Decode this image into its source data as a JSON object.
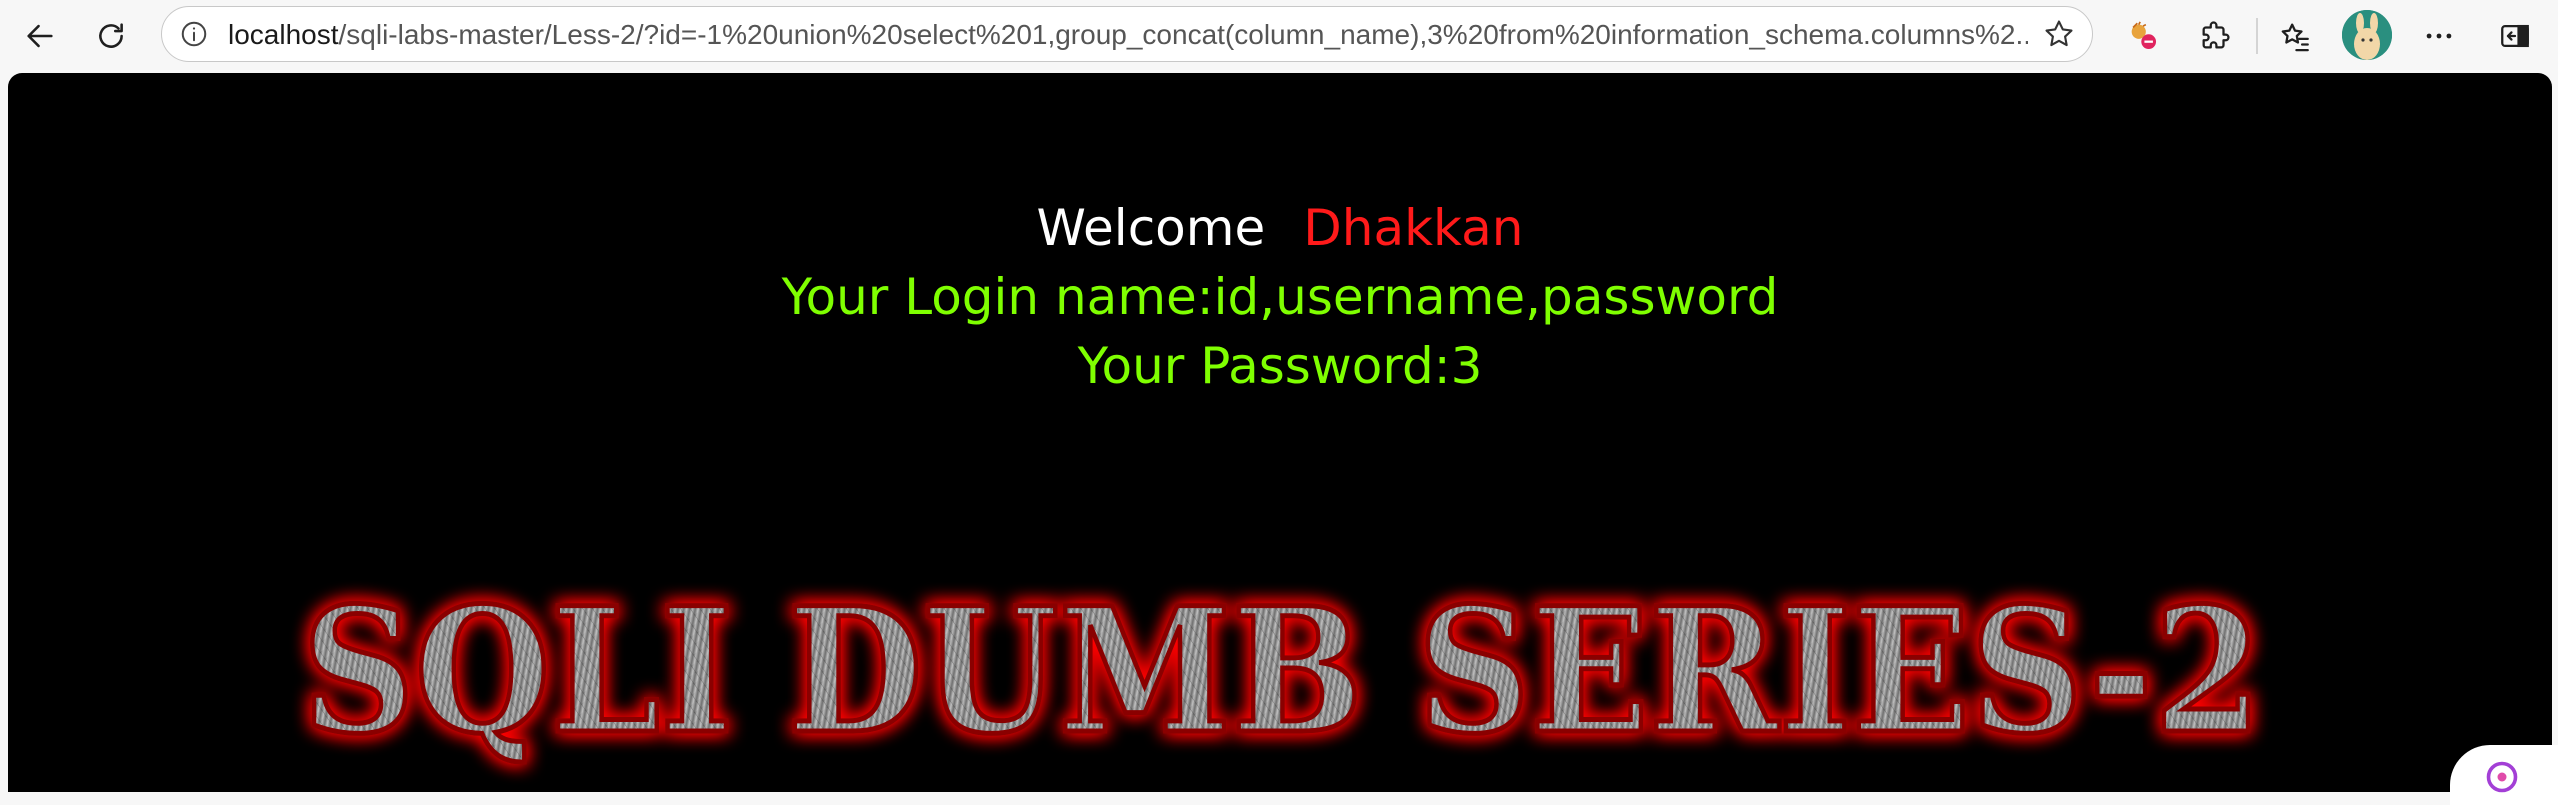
{
  "browser": {
    "url_host": "localhost",
    "url_rest": "/sqli-labs-master/Less-2/?id=-1%20union%20select%201,group_concat(column_name),3%20from%20information_schema.columns%2...",
    "icons": {
      "back": "back-arrow-icon",
      "reload": "reload-icon",
      "info": "site-info-icon",
      "favorite": "star-icon",
      "extension_blocked": "blocked-extension-icon",
      "extensions": "puzzle-icon",
      "favorites": "favorites-icon",
      "profile": "avatar",
      "more": "more-icon",
      "sidebar": "sidebar-icon"
    }
  },
  "page": {
    "welcome_label": "Welcome",
    "user_name": "Dhakkan",
    "login_line": "Your Login name:id,username,password",
    "password_line": "Your Password:3",
    "banner_text": "SQLI DUMB SERIES-2",
    "colors": {
      "background": "#000000",
      "welcome": "#ffffff",
      "user_name": "#ff1a1a",
      "info_text": "#7fff00",
      "banner_glow": "#ff0000"
    }
  }
}
